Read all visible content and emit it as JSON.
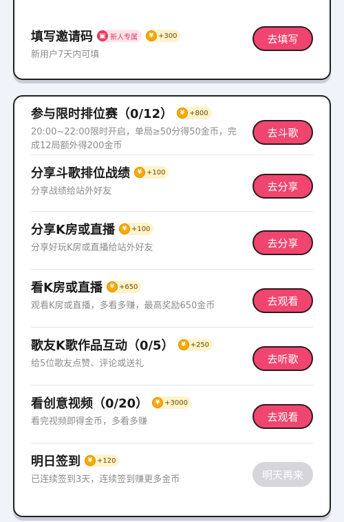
{
  "invite": {
    "title": "填写邀请码",
    "badge": "新人专属",
    "reward": "+300",
    "desc": "新用户7天内可填",
    "button": "去填写"
  },
  "tasks": [
    {
      "title": "参与限时排位赛（0/12）",
      "reward": "+800",
      "desc": "20:00~22:00限时开启，单局≥50分得50金币，完成12局额外得200金币",
      "button": "去斗歌",
      "enabled": true
    },
    {
      "title": "分享斗歌排位战绩",
      "reward": "+100",
      "desc": "分享战绩给站外好友",
      "button": "去分享",
      "enabled": true
    },
    {
      "title": "分享K房或直播",
      "reward": "+100",
      "desc": "分享好玩K房或直播给站外好友",
      "button": "去分享",
      "enabled": true
    },
    {
      "title": "看K房或直播",
      "reward": "+650",
      "desc": "观看K房或直播，多看多赚，最高奖励650金币",
      "button": "去观看",
      "enabled": true
    },
    {
      "title": "歌友K歌作品互动（0/5）",
      "reward": "+250",
      "desc": "给5位歌友点赞、评论或送礼",
      "button": "去听歌",
      "enabled": true
    },
    {
      "title": "看创意视频（0/20）",
      "reward": "+3000",
      "desc": "看完视频即得金币，多看多赚",
      "button": "去观看",
      "enabled": true
    },
    {
      "title": "明日签到",
      "reward": "+120",
      "desc": "已连续签到3天，连续签到赚更多金币",
      "button": "明天再来",
      "enabled": false
    }
  ],
  "colors": {
    "button": "#f0456f",
    "button_disabled": "#d6d6da",
    "coin": "#f5a90a",
    "background": "#eef4fa"
  },
  "icons": {
    "coin": "coin-icon",
    "gift": "gift-icon"
  }
}
